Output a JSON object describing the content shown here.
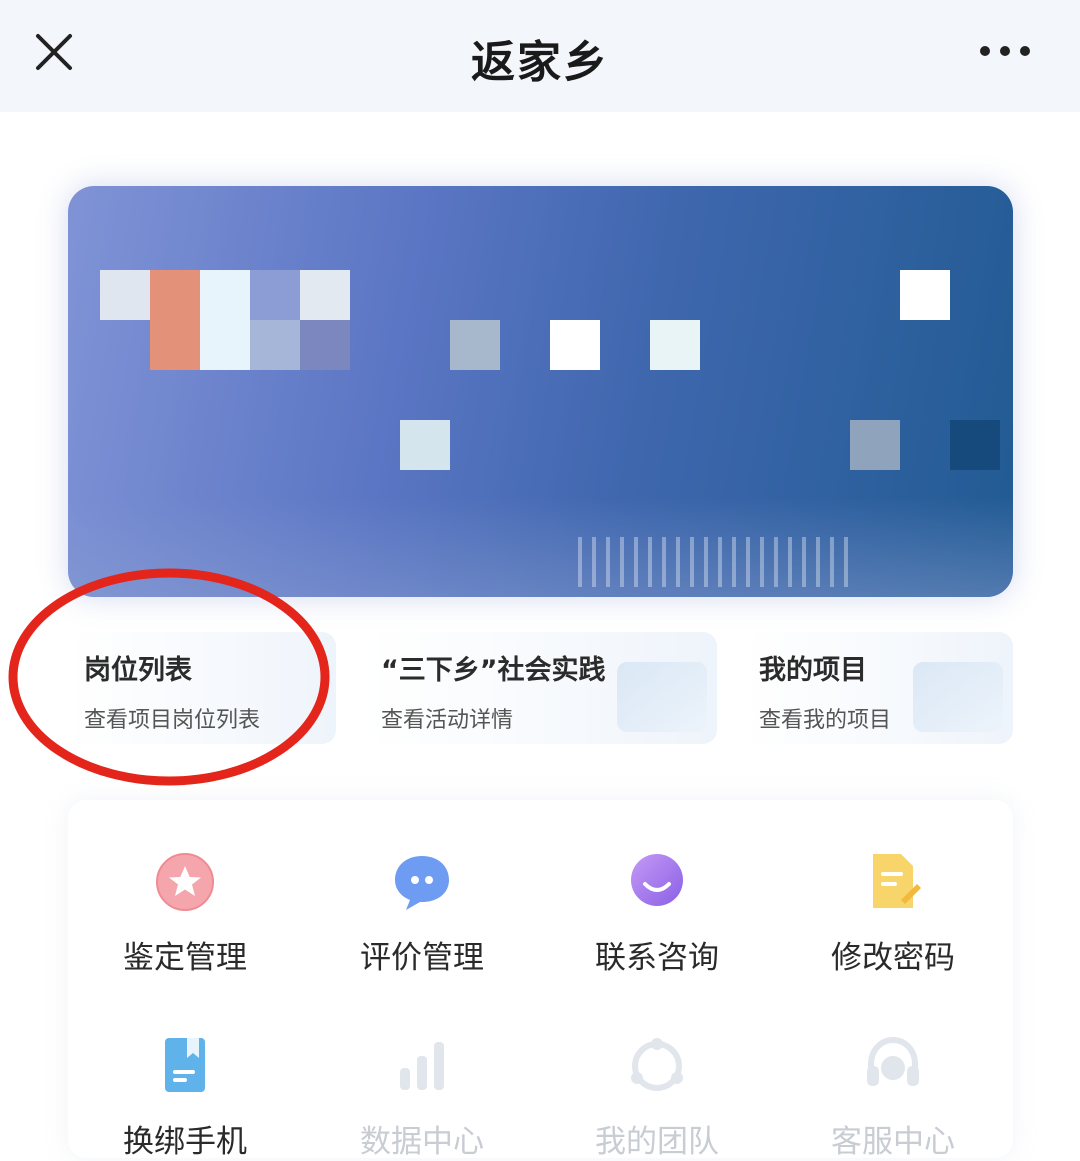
{
  "header": {
    "title": "返家乡",
    "close_icon": "close-icon",
    "more_icon": "more-dots-icon"
  },
  "cards": [
    {
      "title": "岗位列表",
      "subtitle": "查看项目岗位列表"
    },
    {
      "title": "“三下乡”社会实践",
      "subtitle": "查看活动详情"
    },
    {
      "title": "我的项目",
      "subtitle": "查看我的项目"
    }
  ],
  "menu": [
    {
      "label": "鉴定管理",
      "icon": "star-badge-icon",
      "color": "#f08a93",
      "enabled": true
    },
    {
      "label": "评价管理",
      "icon": "chat-bubble-icon",
      "color": "#5f8ff0",
      "enabled": true
    },
    {
      "label": "联系咨询",
      "icon": "smile-icon",
      "color": "#9a6ee8",
      "enabled": true
    },
    {
      "label": "修改密码",
      "icon": "edit-document-icon",
      "color": "#f6cf55",
      "enabled": true
    },
    {
      "label": "换绑手机",
      "icon": "book-icon",
      "color": "#4ea9e6",
      "enabled": true
    },
    {
      "label": "数据中心",
      "icon": "bar-chart-icon",
      "color": "#d3d8e0",
      "enabled": false
    },
    {
      "label": "我的团队",
      "icon": "team-icon",
      "color": "#d3d8e0",
      "enabled": false
    },
    {
      "label": "客服中心",
      "icon": "headset-icon",
      "color": "#d3d8e0",
      "enabled": false
    }
  ],
  "colors": {
    "annotation": "#e3251b",
    "header_bg": "#f3f6fb"
  }
}
